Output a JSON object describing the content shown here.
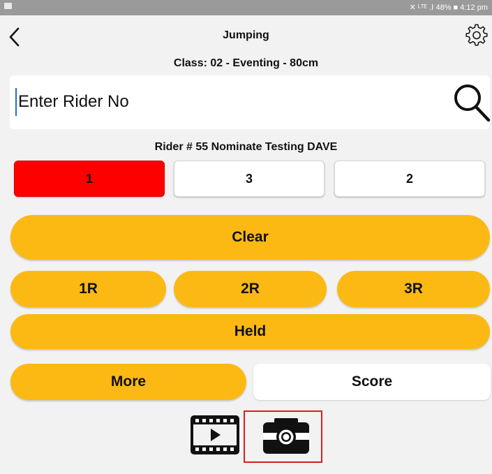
{
  "status_bar": {
    "right_text": "✕ ᴸᵀᴱ .ⵏ 48% ■ 4:12 pm"
  },
  "header": {
    "title": "Jumping",
    "subtitle": "Class: 02 - Eventing - 80cm"
  },
  "search": {
    "placeholder": "Enter Rider No"
  },
  "rider": {
    "label": "Rider # 55 Nominate Testing DAVE"
  },
  "rounds": [
    {
      "label": "1",
      "selected": true,
      "color": "#ff0000"
    },
    {
      "label": "3",
      "selected": false,
      "color": "#ffffff"
    },
    {
      "label": "2",
      "selected": false,
      "color": "#ffffff"
    }
  ],
  "actions": {
    "clear": "Clear",
    "r1": "1R",
    "r2": "2R",
    "r3": "3R",
    "held": "Held",
    "more": "More",
    "score": "Score"
  },
  "icons": {
    "back": "chevron-left-icon",
    "settings": "gear-icon",
    "search": "search-icon",
    "video": "video-icon",
    "camera": "camera-icon"
  },
  "colors": {
    "accent": "#fdb913",
    "selected_round": "#ff0000",
    "highlight_box": "#d61f1f"
  }
}
